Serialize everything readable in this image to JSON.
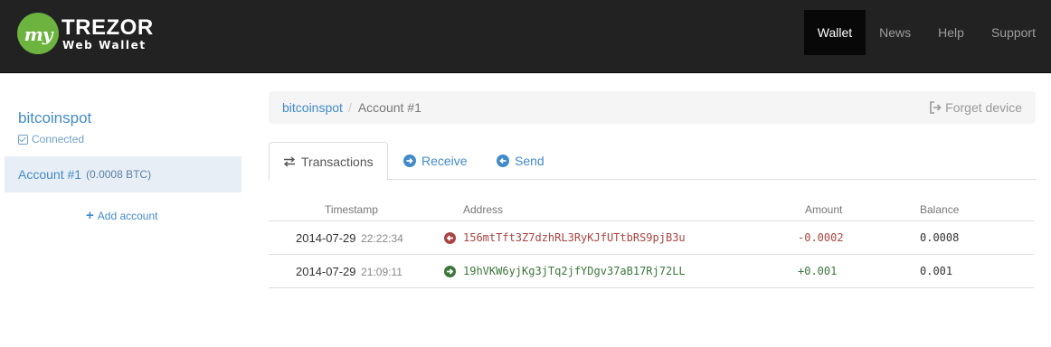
{
  "navbar": {
    "logo_mark": "my",
    "brand_title": "TREZOR",
    "brand_subtitle": "Web Wallet",
    "items": [
      {
        "label": "Wallet",
        "active": true
      },
      {
        "label": "News",
        "active": false
      },
      {
        "label": "Help",
        "active": false
      },
      {
        "label": "Support",
        "active": false
      }
    ]
  },
  "sidebar": {
    "device_name": "bitcoinspot",
    "device_status": "Connected",
    "account": {
      "name": "Account #1",
      "balance": "(0.0008 BTC)"
    },
    "add_account": "Add account"
  },
  "breadcrumb": {
    "device": "bitcoinspot",
    "separator": "/",
    "current": "Account #1",
    "forget_device": "Forget device"
  },
  "tabs": [
    {
      "label": "Transactions",
      "icon": "swap-arrows-icon",
      "active": true
    },
    {
      "label": "Receive",
      "icon": "arrow-circle-right-icon",
      "active": false
    },
    {
      "label": "Send",
      "icon": "arrow-circle-left-icon",
      "active": false
    }
  ],
  "table": {
    "headers": {
      "timestamp": "Timestamp",
      "address": "Address",
      "amount": "Amount",
      "balance": "Balance"
    },
    "rows": [
      {
        "date": "2014-07-29",
        "time": "22:22:34",
        "direction": "outgoing",
        "address": "156mtTft3Z7dzhRL3RyKJfUTtbRS9pjB3u",
        "amount": "-0.0002",
        "balance": "0.0008"
      },
      {
        "date": "2014-07-29",
        "time": "21:09:11",
        "direction": "incoming",
        "address": "19hVKW6yjKg3jTq2jfYDgv37aB17Rj72LL",
        "amount": "+0.001",
        "balance": "0.001"
      }
    ]
  },
  "colors": {
    "navbar_bg": "#222222",
    "logo_green": "#6cb33f",
    "link_blue": "#428bca",
    "outgoing_red": "#a94442",
    "incoming_green": "#3c763d"
  }
}
